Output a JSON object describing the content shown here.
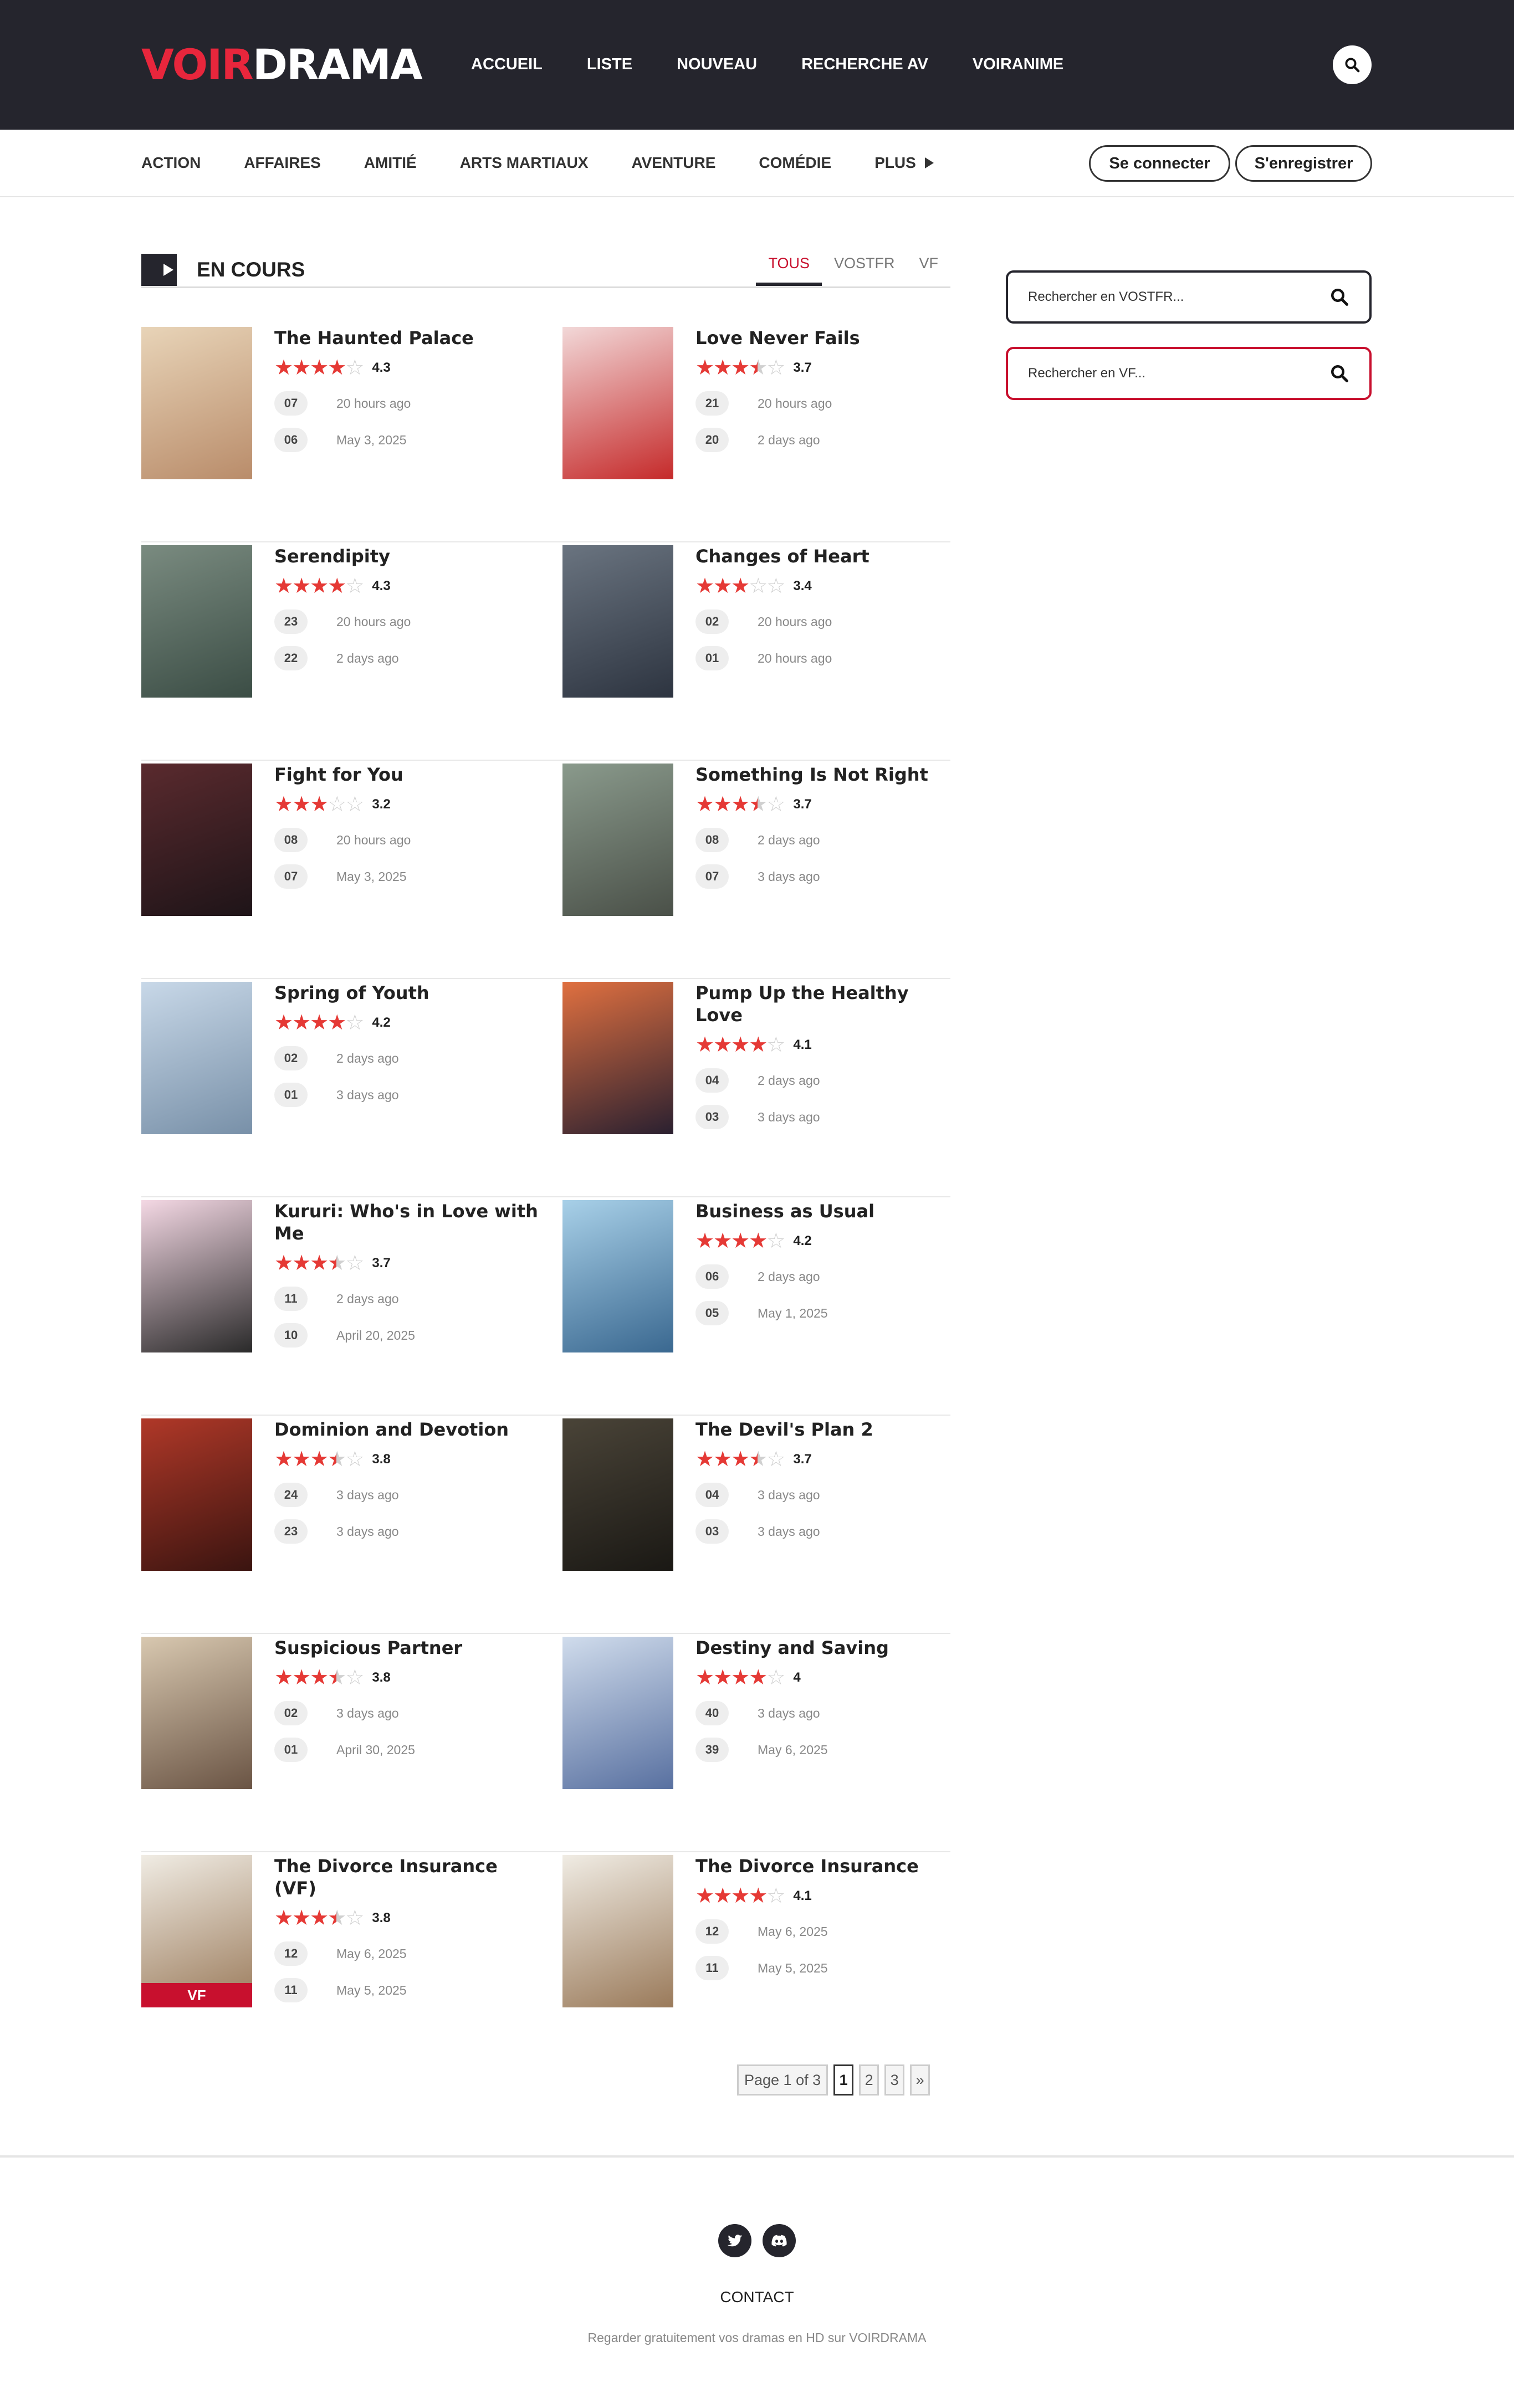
{
  "site": {
    "logo_part1": "VOIR",
    "logo_part2": "DRAMA"
  },
  "nav": [
    "ACCUEIL",
    "LISTE",
    "NOUVEAU",
    "RECHERCHE AV",
    "VOIRANIME"
  ],
  "categories": [
    "ACTION",
    "AFFAIRES",
    "AMITIÉ",
    "ARTS MARTIAUX",
    "AVENTURE",
    "COMÉDIE",
    "PLUS"
  ],
  "auth": {
    "login": "Se connecter",
    "register": "S'enregistrer"
  },
  "section": {
    "title": "EN COURS",
    "tabs": [
      "TOUS",
      "VOSTFR",
      "VF"
    ],
    "active_tab": "TOUS"
  },
  "colors": {
    "accent": "#c8102e",
    "dark": "#25252d",
    "star": "#e53935"
  },
  "dramas": [
    {
      "title": "The Haunted Palace",
      "rating": "4.3",
      "episodes": [
        {
          "num": "07",
          "time": "20 hours ago"
        },
        {
          "num": "06",
          "time": "May 3, 2025"
        }
      ],
      "poster": [
        "#e8d4b8",
        "#b98c6a"
      ]
    },
    {
      "title": "Love Never Fails",
      "rating": "3.7",
      "episodes": [
        {
          "num": "21",
          "time": "20 hours ago"
        },
        {
          "num": "20",
          "time": "2 days ago"
        }
      ],
      "poster": [
        "#f2d8d8",
        "#c52a2a"
      ]
    },
    {
      "title": "Serendipity",
      "rating": "4.3",
      "episodes": [
        {
          "num": "23",
          "time": "20 hours ago"
        },
        {
          "num": "22",
          "time": "2 days ago"
        }
      ],
      "poster": [
        "#7a8b80",
        "#3b4d45"
      ]
    },
    {
      "title": "Changes of Heart",
      "rating": "3.4",
      "episodes": [
        {
          "num": "02",
          "time": "20 hours ago"
        },
        {
          "num": "01",
          "time": "20 hours ago"
        }
      ],
      "poster": [
        "#6a7480",
        "#2d3440"
      ]
    },
    {
      "title": "Fight for You",
      "rating": "3.2",
      "episodes": [
        {
          "num": "08",
          "time": "20 hours ago"
        },
        {
          "num": "07",
          "time": "May 3, 2025"
        }
      ],
      "poster": [
        "#5a2a2e",
        "#1e1418"
      ]
    },
    {
      "title": "Something Is Not Right",
      "rating": "3.7",
      "episodes": [
        {
          "num": "08",
          "time": "2 days ago"
        },
        {
          "num": "07",
          "time": "3 days ago"
        }
      ],
      "poster": [
        "#8a9a8c",
        "#4a5048"
      ]
    },
    {
      "title": "Spring of Youth",
      "rating": "4.2",
      "episodes": [
        {
          "num": "02",
          "time": "2 days ago"
        },
        {
          "num": "01",
          "time": "3 days ago"
        }
      ],
      "poster": [
        "#c8d8e8",
        "#7890a8"
      ]
    },
    {
      "title": "Pump Up the Healthy Love",
      "rating": "4.1",
      "episodes": [
        {
          "num": "04",
          "time": "2 days ago"
        },
        {
          "num": "03",
          "time": "3 days ago"
        }
      ],
      "poster": [
        "#e07040",
        "#2a2030"
      ]
    },
    {
      "title": "Kururi: Who's in Love with Me",
      "rating": "3.7",
      "episodes": [
        {
          "num": "11",
          "time": "2 days ago"
        },
        {
          "num": "10",
          "time": "April 20, 2025"
        }
      ],
      "poster": [
        "#f4d8e4",
        "#2a2a2a"
      ]
    },
    {
      "title": "Business as Usual",
      "rating": "4.2",
      "episodes": [
        {
          "num": "06",
          "time": "2 days ago"
        },
        {
          "num": "05",
          "time": "May 1, 2025"
        }
      ],
      "poster": [
        "#a8d0e8",
        "#3a6890"
      ]
    },
    {
      "title": "Dominion and Devotion",
      "rating": "3.8",
      "episodes": [
        {
          "num": "24",
          "time": "3 days ago"
        },
        {
          "num": "23",
          "time": "3 days ago"
        }
      ],
      "poster": [
        "#b03828",
        "#3a1410"
      ]
    },
    {
      "title": "The Devil's Plan 2",
      "rating": "3.7",
      "episodes": [
        {
          "num": "04",
          "time": "3 days ago"
        },
        {
          "num": "03",
          "time": "3 days ago"
        }
      ],
      "poster": [
        "#4a4438",
        "#1a1814"
      ]
    },
    {
      "title": "Suspicious Partner",
      "rating": "3.8",
      "episodes": [
        {
          "num": "02",
          "time": "3 days ago"
        },
        {
          "num": "01",
          "time": "April 30, 2025"
        }
      ],
      "poster": [
        "#d8c8b0",
        "#6a5444"
      ]
    },
    {
      "title": "Destiny and Saving",
      "rating": "4",
      "episodes": [
        {
          "num": "40",
          "time": "3 days ago"
        },
        {
          "num": "39",
          "time": "May 6, 2025"
        }
      ],
      "poster": [
        "#d0dcec",
        "#5870a0"
      ]
    },
    {
      "title": "The Divorce Insurance (VF)",
      "rating": "3.8",
      "episodes": [
        {
          "num": "12",
          "time": "May 6, 2025"
        },
        {
          "num": "11",
          "time": "May 5, 2025"
        }
      ],
      "poster": [
        "#f0ece4",
        "#9a7a5a"
      ],
      "badge": "VF"
    },
    {
      "title": "The Divorce Insurance",
      "rating": "4.1",
      "episodes": [
        {
          "num": "12",
          "time": "May 6, 2025"
        },
        {
          "num": "11",
          "time": "May 5, 2025"
        }
      ],
      "poster": [
        "#f0ece4",
        "#9a7a5a"
      ]
    }
  ],
  "sidebar": {
    "search_vostfr": "Rechercher en VOSTFR...",
    "search_vf": "Rechercher en VF..."
  },
  "pagination": {
    "label": "Page 1 of 3",
    "pages": [
      "1",
      "2",
      "3"
    ],
    "current": "1",
    "next": "»"
  },
  "footer": {
    "contact": "CONTACT",
    "tagline": "Regarder gratuitement vos dramas en HD sur VOIRDRAMA",
    "social": [
      "twitter-icon",
      "discord-icon"
    ]
  }
}
